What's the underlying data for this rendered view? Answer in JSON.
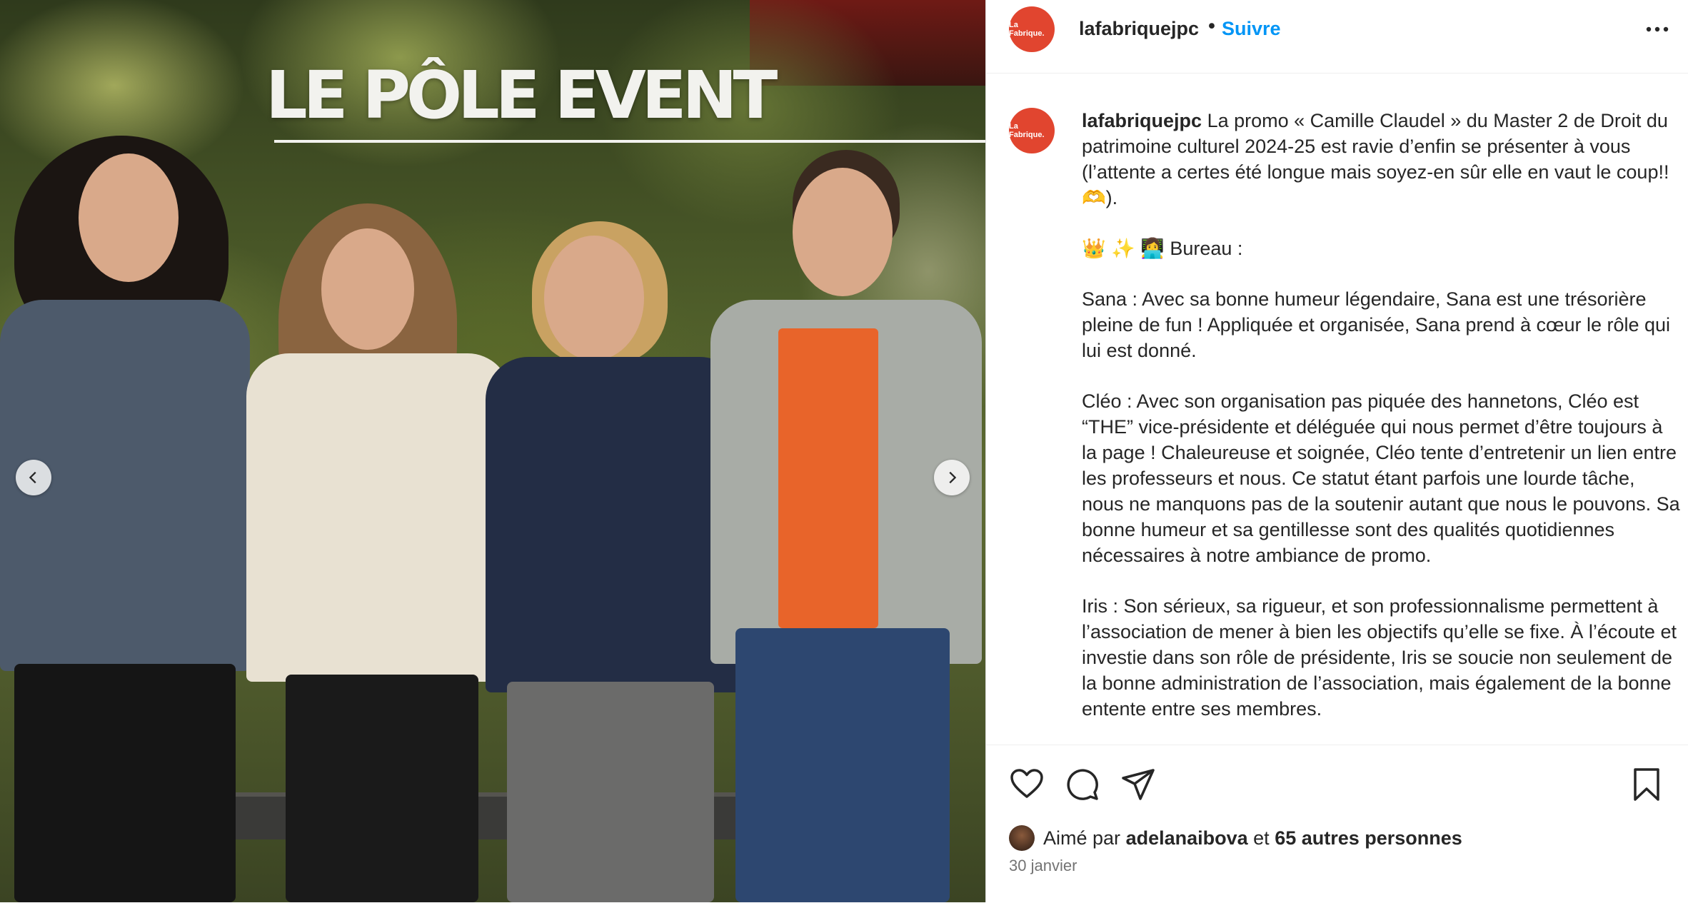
{
  "photo": {
    "overlay_title": "LE PÔLE EVENT"
  },
  "header": {
    "avatar_text": "La Fabrique.",
    "username": "lafabriquejpc",
    "separator": "•",
    "follow_label": "Suivre",
    "more_icon": "more-horizontal-icon"
  },
  "caption": {
    "avatar_text": "La Fabrique.",
    "username": "lafabriquejpc",
    "paragraphs": [
      "La promo « Camille Claudel » du Master 2 de Droit du patrimoine culturel 2024-25 est ravie d’enfin se présenter à vous (l’attente a certes été longue mais soyez-en sûr elle en vaut le coup!!🫶).",
      "👑 ✨ 👩‍💻 Bureau :",
      "Sana : Avec sa bonne humeur légendaire, Sana est une trésorière pleine de fun ! Appliquée et organisée, Sana prend à cœur le rôle qui lui est donné.",
      "Cléo : Avec son organisation pas piquée des hannetons, Cléo est “THE” vice-présidente et déléguée qui nous permet d’être toujours à la page ! Chaleureuse et soignée, Cléo tente d’entretenir un lien entre les professeurs et nous. Ce statut étant parfois une lourde tâche, nous ne manquons pas de la soutenir autant que nous le pouvons. Sa bonne humeur et sa gentillesse sont des qualités quotidiennes nécessaires à notre ambiance de promo.",
      "Iris : Son sérieux, sa rigueur, et son professionnalisme permettent à l’association de mener à bien les objectifs qu’elle se fixe. À l’écoute et investie dans son rôle de présidente, Iris se soucie non seulement de la bonne administration de l’association, mais également de la bonne entente entre ses membres."
    ]
  },
  "actions": {
    "icons": [
      "heart-icon",
      "comment-icon",
      "share-icon",
      "bookmark-icon"
    ]
  },
  "likes": {
    "prefix": "Aimé par",
    "liker": "adelanaibova",
    "conjunction": "et",
    "others": "65 autres personnes"
  },
  "date": "30 janvier",
  "colors": {
    "accent": "#0095f6",
    "brand": "#e1452f",
    "text": "#262626",
    "muted": "#737373"
  }
}
